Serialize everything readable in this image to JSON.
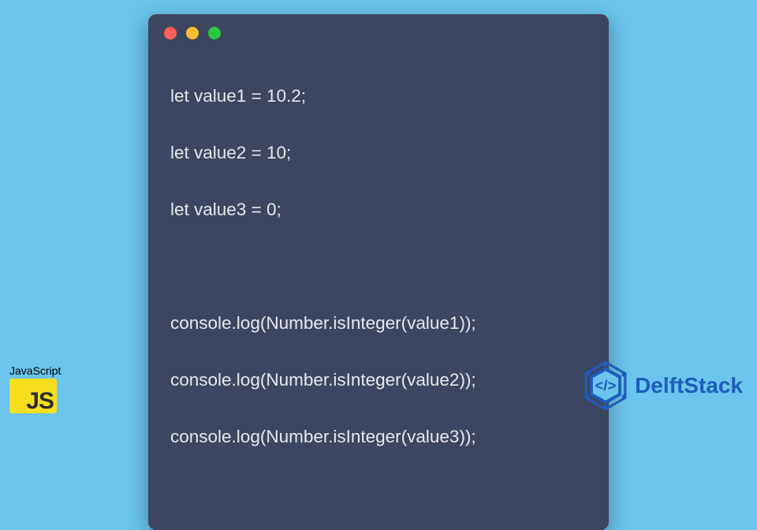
{
  "code": {
    "lines": [
      "let value1 = 10.2;",
      "let value2 = 10;",
      "let value3 = 0;",
      "",
      "console.log(Number.isInteger(value1));",
      "console.log(Number.isInteger(value2));",
      "console.log(Number.isInteger(value3));"
    ]
  },
  "badge": {
    "label": "JavaScript",
    "logo_text": "JS"
  },
  "brand": {
    "name": "DelftStack"
  },
  "colors": {
    "background": "#6bc5ee",
    "window": "#3d4661",
    "js_logo": "#f7df1e",
    "brand": "#1e5dbb"
  }
}
